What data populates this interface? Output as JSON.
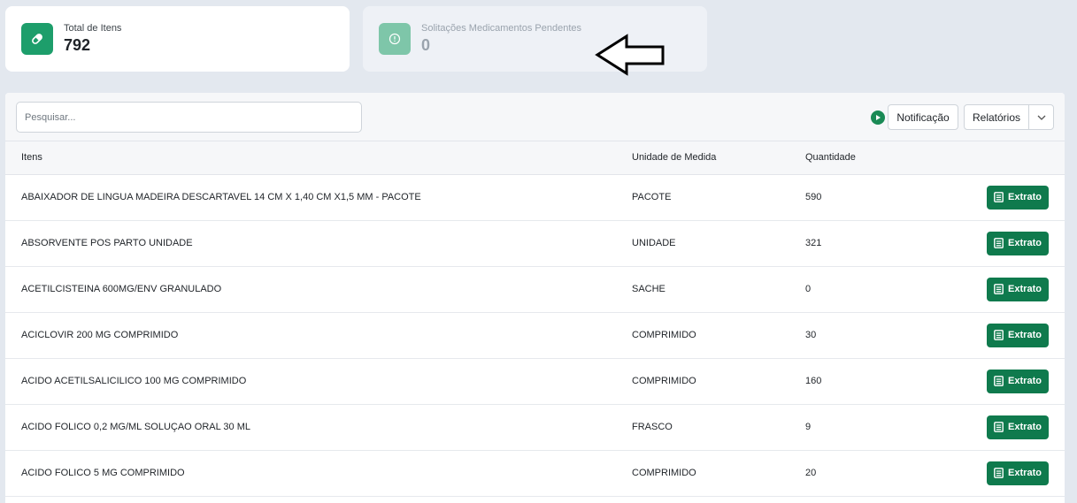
{
  "cards": {
    "total": {
      "label": "Total de Itens",
      "value": "792",
      "icon": "pill-icon"
    },
    "pending": {
      "label": "Solitações Medicamentos Pendentes",
      "value": "0",
      "icon": "info-icon"
    }
  },
  "toolbar": {
    "search_placeholder": "Pesquisar...",
    "notification_label": "Notificação",
    "reports_label": "Relatórios"
  },
  "table": {
    "headers": {
      "items": "Itens",
      "unit": "Unidade de Medida",
      "quantity": "Quantidade"
    },
    "action_label": "Extrato",
    "rows": [
      {
        "item": "ABAIXADOR DE LINGUA MADEIRA DESCARTAVEL 14 CM X 1,40 CM X1,5 MM - PACOTE",
        "unit": "PACOTE",
        "qty": "590"
      },
      {
        "item": "ABSORVENTE POS PARTO UNIDADE",
        "unit": "UNIDADE",
        "qty": "321"
      },
      {
        "item": "ACETILCISTEINA 600MG/ENV GRANULADO",
        "unit": "SACHE",
        "qty": "0"
      },
      {
        "item": "ACICLOVIR 200 MG COMPRIMIDO",
        "unit": "COMPRIMIDO",
        "qty": "30"
      },
      {
        "item": "ACIDO ACETILSALICILICO 100 MG COMPRIMIDO",
        "unit": "COMPRIMIDO",
        "qty": "160"
      },
      {
        "item": "ACIDO FOLICO 0,2 MG/ML SOLUÇAO ORAL 30 ML",
        "unit": "FRASCO",
        "qty": "9"
      },
      {
        "item": "ACIDO FOLICO 5 MG COMPRIMIDO",
        "unit": "COMPRIMIDO",
        "qty": "20"
      }
    ]
  },
  "colors": {
    "accent": "#0f7a4d",
    "card_icon": "#1d9e6b"
  }
}
